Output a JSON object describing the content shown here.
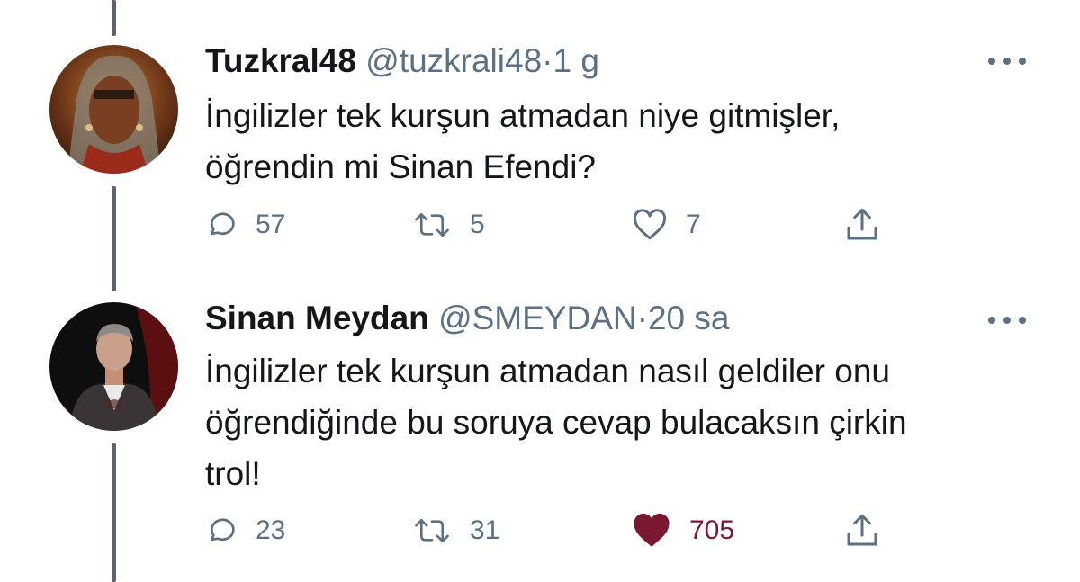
{
  "tweets": [
    {
      "name": "Tuzkral48",
      "handle": "@tuzkrali48",
      "separator": "·",
      "time": "1 g",
      "text_lines": [
        "İngilizler tek kurşun atmadan niye gitmişler,",
        "öğrendin mi Sinan Efendi?"
      ],
      "replies": "57",
      "retweets": "5",
      "likes": "7",
      "liked": false
    },
    {
      "name": "Sinan Meydan",
      "handle": "@SMEYDAN",
      "separator": "·",
      "time": "20 sa",
      "text_lines": [
        "İngilizler tek kurşun atmadan nasıl geldiler onu",
        "öğrendiğinde bu soruya cevap bulacaksın çirkin",
        "trol!"
      ],
      "replies": "23",
      "retweets": "31",
      "likes": "705",
      "liked": true
    }
  ],
  "icons": {
    "reply": "reply-icon",
    "retweet": "retweet-icon",
    "like": "heart-icon",
    "share": "share-icon",
    "more": "more-icon"
  },
  "colors": {
    "like_active": "#7a1832",
    "muted": "#5b7083",
    "thread_line": "#5f6368"
  }
}
